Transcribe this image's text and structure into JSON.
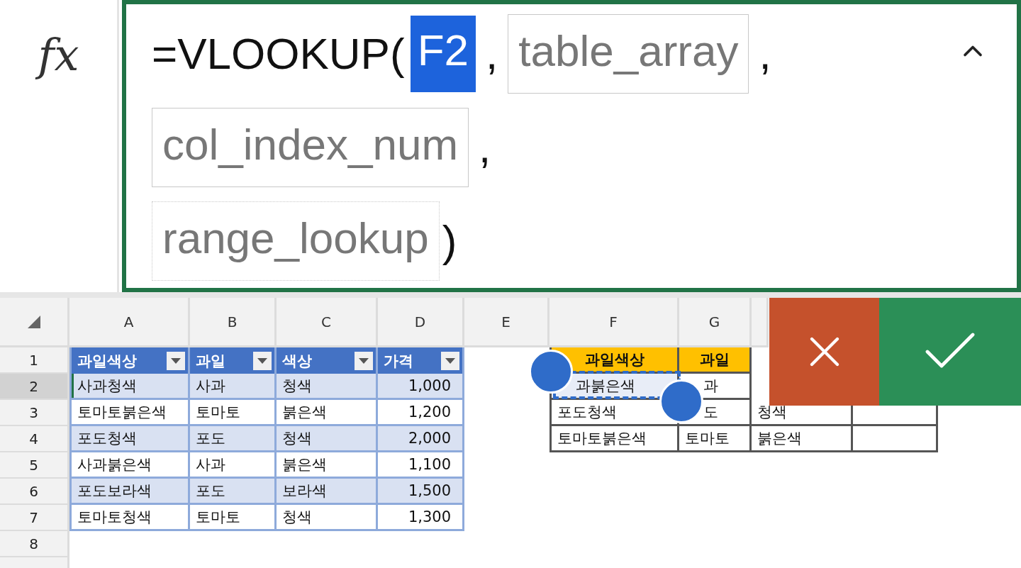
{
  "formula_bar": {
    "fx_label": "fx",
    "lines": [
      [
        {
          "kind": "text",
          "text": "=VLOOKUP("
        },
        {
          "kind": "ref",
          "text": "F2"
        },
        {
          "kind": "sep",
          "text": ","
        },
        {
          "kind": "arg",
          "text": "table_array",
          "optional": false
        },
        {
          "kind": "sep",
          "text": ","
        }
      ],
      [
        {
          "kind": "arg",
          "text": "col_index_num",
          "optional": false
        },
        {
          "kind": "sep",
          "text": ","
        }
      ],
      [
        {
          "kind": "arg",
          "text": "range_lookup",
          "optional": true
        },
        {
          "kind": "text",
          "text": ")"
        }
      ]
    ]
  },
  "sheet": {
    "columns": [
      {
        "label": "A",
        "selected": false
      },
      {
        "label": "B",
        "selected": false
      },
      {
        "label": "C",
        "selected": false
      },
      {
        "label": "D",
        "selected": false
      },
      {
        "label": "E",
        "selected": false
      },
      {
        "label": "F",
        "selected": false
      },
      {
        "label": "G",
        "selected": false
      }
    ],
    "rows": [
      {
        "header": "1",
        "selected": false,
        "cells": [
          {
            "kind": "th",
            "text": "과일색상"
          },
          {
            "kind": "th",
            "text": "과일"
          },
          {
            "kind": "th",
            "text": "색상"
          },
          {
            "kind": "th",
            "text": "가격"
          },
          {
            "kind": "blank"
          },
          {
            "kind": "lh",
            "text": "과일색상"
          },
          {
            "kind": "lh",
            "text": "과일"
          },
          {
            "kind": "blank"
          },
          {
            "kind": "blank"
          }
        ]
      },
      {
        "header": "2",
        "selected": true,
        "cells": [
          {
            "kind": "td",
            "text": "사과청색",
            "banded": true,
            "active": true
          },
          {
            "kind": "td",
            "text": "사과",
            "banded": true
          },
          {
            "kind": "td",
            "text": "청색",
            "banded": true
          },
          {
            "kind": "num",
            "text": "1,000",
            "banded": true
          },
          {
            "kind": "blank"
          },
          {
            "kind": "ld",
            "text": "과붉은색",
            "under_handle": true,
            "referenced": true
          },
          {
            "kind": "ld",
            "text": "과",
            "under_handle": true
          },
          {
            "kind": "blank"
          },
          {
            "kind": "blank"
          }
        ]
      },
      {
        "header": "3",
        "selected": false,
        "cells": [
          {
            "kind": "td",
            "text": "토마토붉은색",
            "banded": false
          },
          {
            "kind": "td",
            "text": "토마토",
            "banded": false
          },
          {
            "kind": "td",
            "text": "붉은색",
            "banded": false
          },
          {
            "kind": "num",
            "text": "1,200",
            "banded": false
          },
          {
            "kind": "blank"
          },
          {
            "kind": "ld",
            "text": "포도청색"
          },
          {
            "kind": "ld",
            "text": "도",
            "under_handle": true
          },
          {
            "kind": "ld",
            "text": "청색"
          },
          {
            "kind": "ld"
          }
        ]
      },
      {
        "header": "4",
        "selected": false,
        "cells": [
          {
            "kind": "td",
            "text": "포도청색",
            "banded": true
          },
          {
            "kind": "td",
            "text": "포도",
            "banded": true
          },
          {
            "kind": "td",
            "text": "청색",
            "banded": true
          },
          {
            "kind": "num",
            "text": "2,000",
            "banded": true
          },
          {
            "kind": "blank"
          },
          {
            "kind": "ld",
            "text": "토마토붉은색"
          },
          {
            "kind": "ld",
            "text": "토마토"
          },
          {
            "kind": "ld",
            "text": "붉은색"
          },
          {
            "kind": "ld"
          }
        ]
      },
      {
        "header": "5",
        "selected": false,
        "cells": [
          {
            "kind": "td",
            "text": "사과붉은색",
            "banded": false
          },
          {
            "kind": "td",
            "text": "사과",
            "banded": false
          },
          {
            "kind": "td",
            "text": "붉은색",
            "banded": false
          },
          {
            "kind": "num",
            "text": "1,100",
            "banded": false
          },
          {
            "kind": "blank"
          },
          {
            "kind": "blank"
          },
          {
            "kind": "blank"
          },
          {
            "kind": "blank"
          },
          {
            "kind": "blank"
          }
        ]
      },
      {
        "header": "6",
        "selected": false,
        "cells": [
          {
            "kind": "td",
            "text": "포도보라색",
            "banded": true
          },
          {
            "kind": "td",
            "text": "포도",
            "banded": true
          },
          {
            "kind": "td",
            "text": "보라색",
            "banded": true
          },
          {
            "kind": "num",
            "text": "1,500",
            "banded": true
          },
          {
            "kind": "blank"
          },
          {
            "kind": "blank"
          },
          {
            "kind": "blank"
          },
          {
            "kind": "blank"
          },
          {
            "kind": "blank"
          }
        ]
      },
      {
        "header": "7",
        "selected": false,
        "cells": [
          {
            "kind": "td",
            "text": "토마토청색",
            "banded": false
          },
          {
            "kind": "td",
            "text": "토마토",
            "banded": false
          },
          {
            "kind": "td",
            "text": "청색",
            "banded": false
          },
          {
            "kind": "num",
            "text": "1,300",
            "banded": false
          },
          {
            "kind": "blank"
          },
          {
            "kind": "blank"
          },
          {
            "kind": "blank"
          },
          {
            "kind": "blank"
          },
          {
            "kind": "blank"
          }
        ]
      },
      {
        "header": "8",
        "selected": false,
        "cells": [
          {
            "kind": "blank"
          },
          {
            "kind": "blank"
          },
          {
            "kind": "blank"
          },
          {
            "kind": "blank"
          },
          {
            "kind": "blank"
          },
          {
            "kind": "blank"
          },
          {
            "kind": "blank"
          },
          {
            "kind": "blank"
          },
          {
            "kind": "blank"
          }
        ]
      }
    ]
  }
}
